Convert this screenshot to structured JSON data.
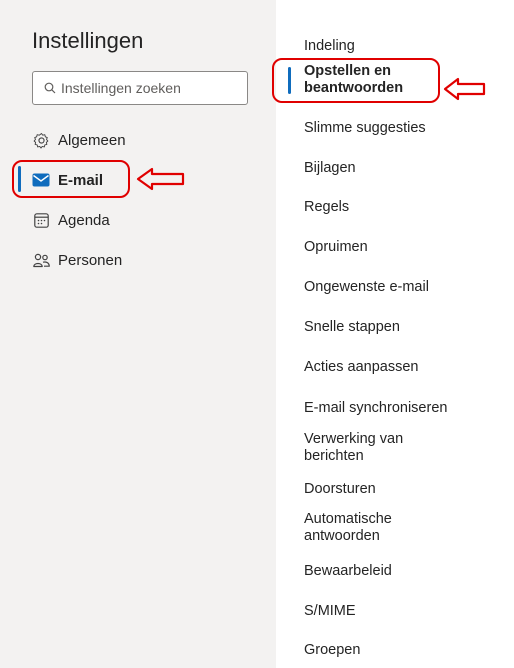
{
  "settings": {
    "title": "Instellingen",
    "search": {
      "placeholder": "Instellingen zoeken"
    },
    "categories": [
      {
        "label": "Algemeen",
        "icon": "gear-icon"
      },
      {
        "label": "E-mail",
        "icon": "mail-icon",
        "selected": true
      },
      {
        "label": "Agenda",
        "icon": "calendar-icon"
      },
      {
        "label": "Personen",
        "icon": "people-icon"
      }
    ],
    "subcategories": [
      {
        "label": "Indeling"
      },
      {
        "label": "Opstellen en beantwoorden",
        "selected": true
      },
      {
        "label": "Slimme suggesties"
      },
      {
        "label": "Bijlagen"
      },
      {
        "label": "Regels"
      },
      {
        "label": "Opruimen"
      },
      {
        "label": "Ongewenste e-mail"
      },
      {
        "label": "Snelle stappen"
      },
      {
        "label": "Acties aanpassen"
      },
      {
        "label": "E-mail synchroniseren"
      },
      {
        "label": "Verwerking van berichten"
      },
      {
        "label": "Doorsturen"
      },
      {
        "label": "Automatische antwoorden"
      },
      {
        "label": "Bewaarbeleid"
      },
      {
        "label": "S/MIME"
      },
      {
        "label": "Groepen"
      }
    ]
  },
  "colors": {
    "accent": "#0f6cbd",
    "annotation": "#e00000",
    "pane": "#f3f2f1"
  }
}
